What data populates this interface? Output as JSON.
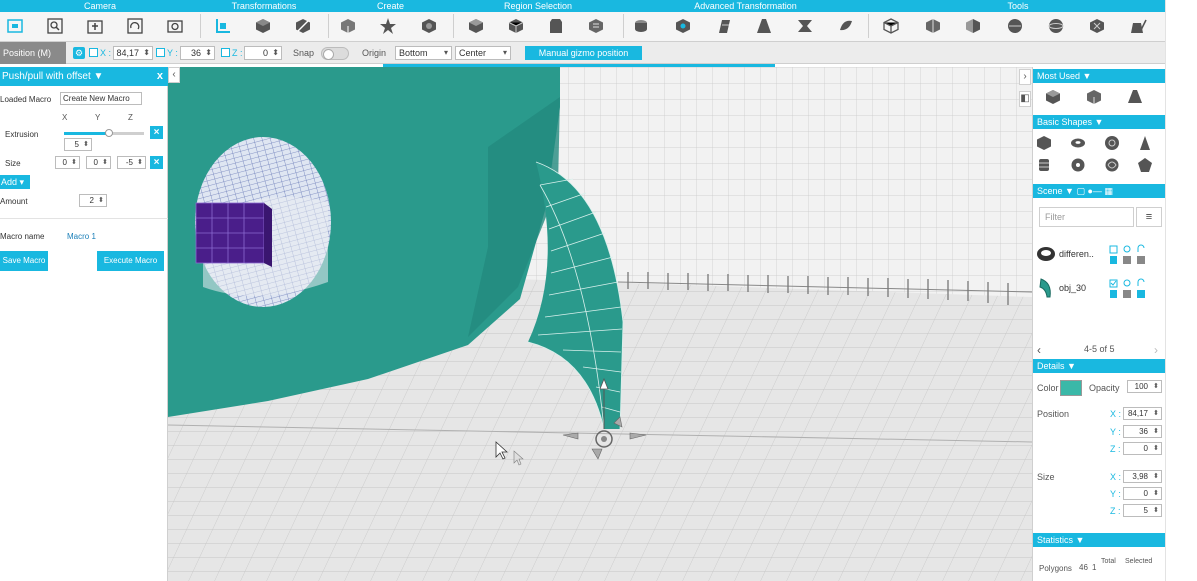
{
  "toolbar": {
    "groups": [
      "Camera",
      "Transformations",
      "Create",
      "Region Selection",
      "Advanced Transformation",
      "Tools"
    ]
  },
  "bar2": {
    "mode": "Position (M)",
    "x_label": "X :",
    "x_value": "84,17",
    "y_label": "Y :",
    "y_value": "36",
    "z_label": "Z :",
    "z_value": "0",
    "snap": "Snap",
    "origin": "Origin",
    "origin_v": "Bottom",
    "origin_h": "Center",
    "manual_gizmo": "Manual gizmo position"
  },
  "left_panel": {
    "title": "Push/pull with offset",
    "close": "x",
    "loaded_macro_label": "Loaded Macro",
    "loaded_macro_value": "Create New Macro",
    "axis_x": "X",
    "axis_y": "Y",
    "axis_z": "Z",
    "extrusion_label": "Extrusion",
    "extrusion_value": "5",
    "extrusion_slider_fraction": 0.56,
    "size_label": "Size",
    "size_x": "0",
    "size_y": "0",
    "size_z": "-5",
    "add": "Add",
    "amount_label": "Amount",
    "amount_value": "2",
    "macro_name_label": "Macro name",
    "macro_name_value": "Macro 1",
    "save_macro": "Save Macro",
    "execute_macro": "Execute Macro",
    "close_glyph": "×"
  },
  "right_panel": {
    "most_used": "Most Used",
    "basic_shapes": "Basic Shapes",
    "scene": "Scene",
    "filter_placeholder": "Filter",
    "scene_items": [
      {
        "name": "differen.."
      },
      {
        "name": "obj_30"
      }
    ],
    "pager": "4-5 of 5",
    "details": "Details",
    "color_label": "Color",
    "opacity_label": "Opacity",
    "opacity_value": "100",
    "position_label": "Position",
    "pos_x_label": "X :",
    "pos_x": "84,17",
    "pos_y_label": "Y :",
    "pos_y": "36",
    "pos_z_label": "Z :",
    "pos_z": "0",
    "size_label": "Size",
    "size_x_label": "X :",
    "size_x": "3,98",
    "size_y_label": "Y :",
    "size_y": "0",
    "size_z_label": "Z :",
    "size_z": "5",
    "statistics": "Statistics",
    "polygons_label": "Polygons",
    "polygons_total": "46",
    "polygons_selected": "1",
    "total_label": "Total",
    "selected_label": "Selected"
  },
  "colors": {
    "accent": "#19b8e0",
    "object_teal": "#2a9a8c",
    "object_color": "#3ab8a8",
    "cube_purple": "#4a1e8a"
  }
}
